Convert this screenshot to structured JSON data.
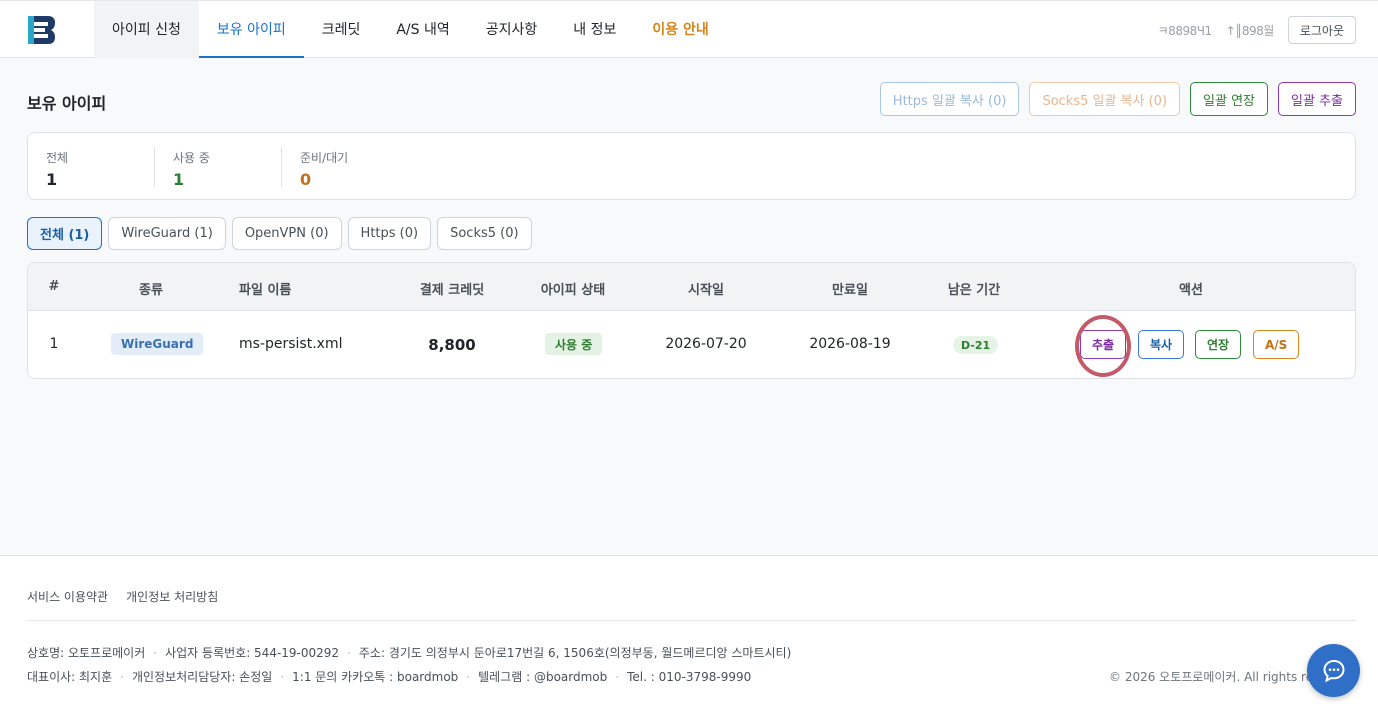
{
  "header": {
    "nav": [
      {
        "label": "아이피 신청"
      },
      {
        "label": "보유 아이피"
      },
      {
        "label": "크레딧"
      },
      {
        "label": "A/S 내역"
      },
      {
        "label": "공지사항"
      },
      {
        "label": "내 정보"
      },
      {
        "label": "이용 안내"
      }
    ],
    "info_1": "ㅋ8898Ч1",
    "info_2": "↑║898월",
    "logout_label": "로그아웃"
  },
  "page": {
    "title": "보유 아이피",
    "actions": {
      "https_copy": "Https 일괄 복사 (0)",
      "socks_copy": "Socks5 일괄 복사 (0)",
      "bulk_extend": "일괄 연장",
      "bulk_extract": "일괄 추출"
    }
  },
  "stats": [
    {
      "label": "전체",
      "value": "1",
      "color": "#212529"
    },
    {
      "label": "사용 중",
      "value": "1",
      "color": "#2e7d32"
    },
    {
      "label": "준비/대기",
      "value": "0",
      "color": "#c2701a"
    }
  ],
  "filters": [
    {
      "label": "전체 (1)"
    },
    {
      "label": "WireGuard (1)"
    },
    {
      "label": "OpenVPN (0)"
    },
    {
      "label": "Https (0)"
    },
    {
      "label": "Socks5 (0)"
    }
  ],
  "table": {
    "headers": {
      "num": "#",
      "type": "종류",
      "filename": "파일 이름",
      "credit": "결제 크레딧",
      "status": "아이피 상태",
      "start": "시작일",
      "end": "만료일",
      "remaining": "남은 기간",
      "actions": "액션"
    },
    "rows": [
      {
        "num": "1",
        "type": "WireGuard",
        "filename": "ms-persist.xml",
        "credit": "8,800",
        "status": "사용 중",
        "start": "2026-07-20",
        "end": "2026-08-19",
        "remaining": "D-21",
        "btn_extract": "추출",
        "btn_copy": "복사",
        "btn_extend": "연장",
        "btn_as": "A/S"
      }
    ]
  },
  "footer": {
    "links": [
      "서비스 이용약관",
      "개인정보 처리방침"
    ],
    "company": "상호명: 오토프로메이커",
    "biz_no": "사업자 등록번호: 544-19-00292",
    "address": "주소: 경기도 의정부시 둔아로17번길 6, 1506호(의정부동, 월드메르디앙 스마트시티)",
    "ceo": "대표이사: 최지훈",
    "privacy_officer": "개인정보처리담당자: 손정일",
    "kakao": "1:1 문의 카카오톡 : boardmob",
    "telegram": "텔레그램 : @boardmob",
    "tel": "Tel. : 010-3798-9990",
    "copyright": "© 2026 오토프로메이커. All rights reserved."
  },
  "colors": {
    "primary": "#1a73c8",
    "success": "#2e7d32",
    "warning": "#d4851b",
    "purple": "#7b2da0",
    "highlight": "#c25a6a"
  }
}
